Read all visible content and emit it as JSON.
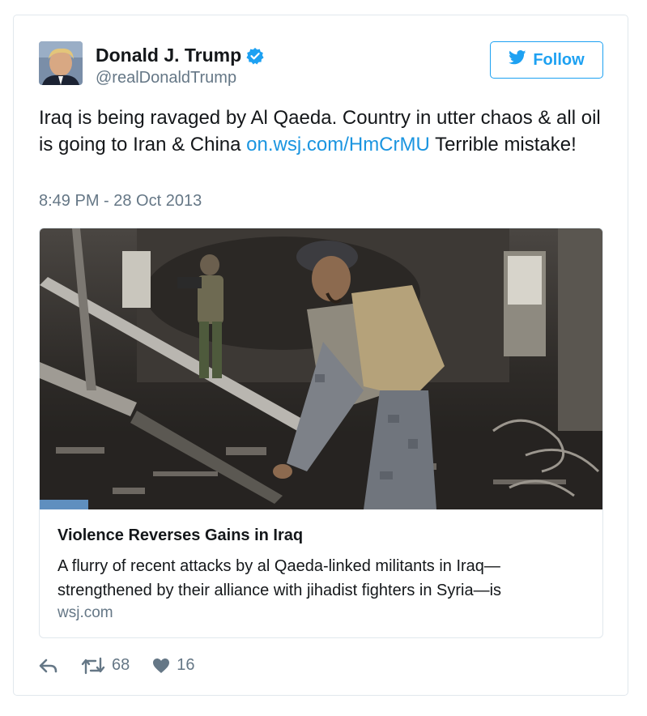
{
  "author": {
    "name": "Donald J. Trump",
    "handle": "@realDonaldTrump",
    "verified": true
  },
  "follow_button": {
    "label": "Follow"
  },
  "tweet": {
    "text_before_link": "Iraq is being ravaged by Al Qaeda. Country in utter chaos & all oil is going to Iran & China ",
    "link_text": "on.wsj.com/HmCrMU",
    "text_after_link": " Terrible mistake!",
    "timestamp": "8:49 PM - 28 Oct 2013"
  },
  "link_card": {
    "headline": "Violence Reverses Gains in Iraq",
    "description": "A flurry of recent attacks by al Qaeda-linked militants in Iraq—strengthened by their alliance with jihadist fighters in Syria—is",
    "domain": "wsj.com"
  },
  "actions": {
    "retweets": "68",
    "likes": "16"
  },
  "icons": {
    "verified": "verified-badge-icon",
    "follow": "twitter-bird-icon",
    "reply": "reply-icon",
    "retweet": "retweet-icon",
    "like": "heart-icon"
  },
  "colors": {
    "accent": "#1da1f2",
    "link": "#1b95e0",
    "muted": "#657786",
    "text": "#14171a"
  }
}
